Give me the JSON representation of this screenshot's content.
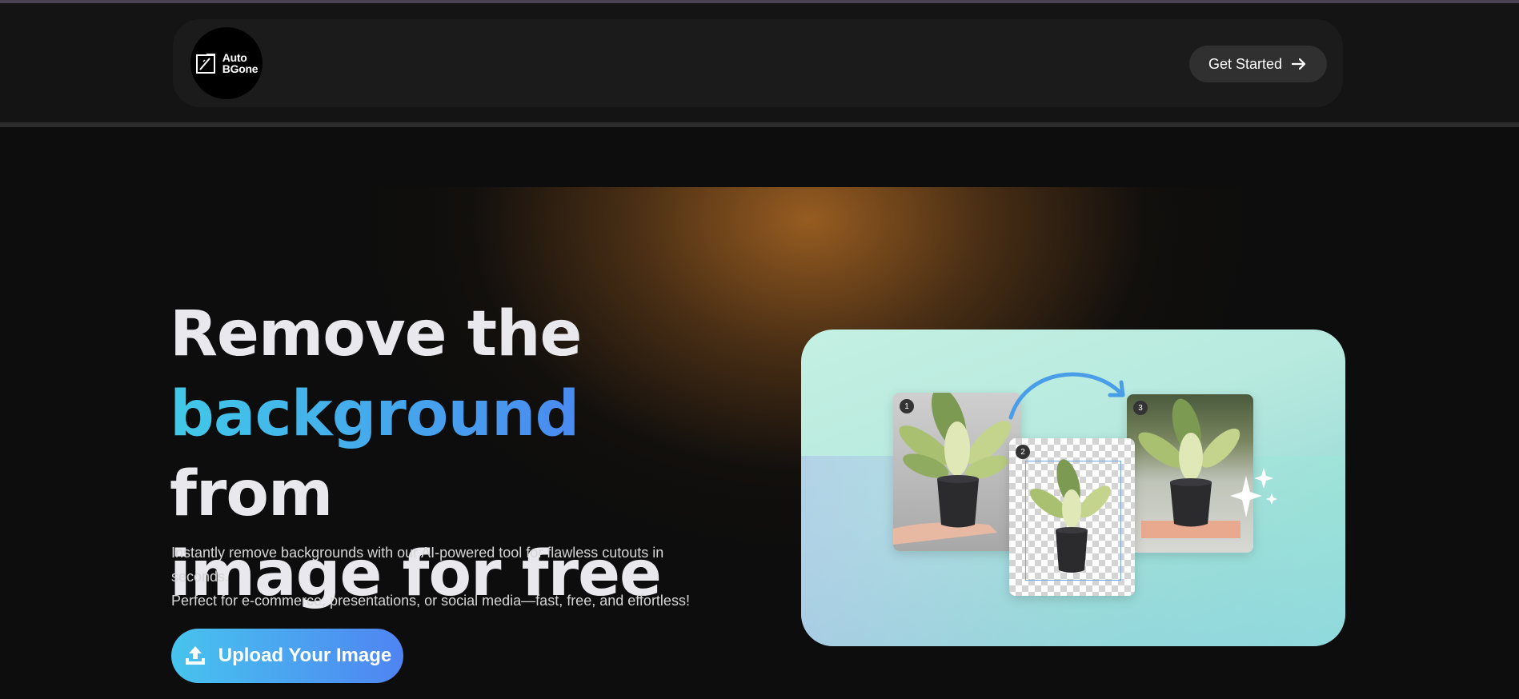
{
  "brand": {
    "logo_line1": "Auto",
    "logo_line2": "BGone"
  },
  "nav": {
    "cta_label": "Get Started",
    "cta_icon": "arrow-right-icon"
  },
  "hero": {
    "headline_line1": "Remove the",
    "headline_highlight": "background",
    "headline_from": " from",
    "headline_line3": "image for free",
    "description_line1": "Instantly remove backgrounds with our AI-powered tool for flawless cutouts in seconds.",
    "description_line2": "Perfect for e-commerce, presentations, or social media—fast, free, and effortless!",
    "upload_label": "Upload Your Image",
    "upload_icon": "upload-icon"
  },
  "illustration": {
    "step1": "1",
    "step2": "2",
    "step3": "3"
  },
  "colors": {
    "background": "#0d0d0d",
    "accent_start": "#41c9e8",
    "accent_end": "#4f84f2",
    "glow": "#9e6022"
  }
}
